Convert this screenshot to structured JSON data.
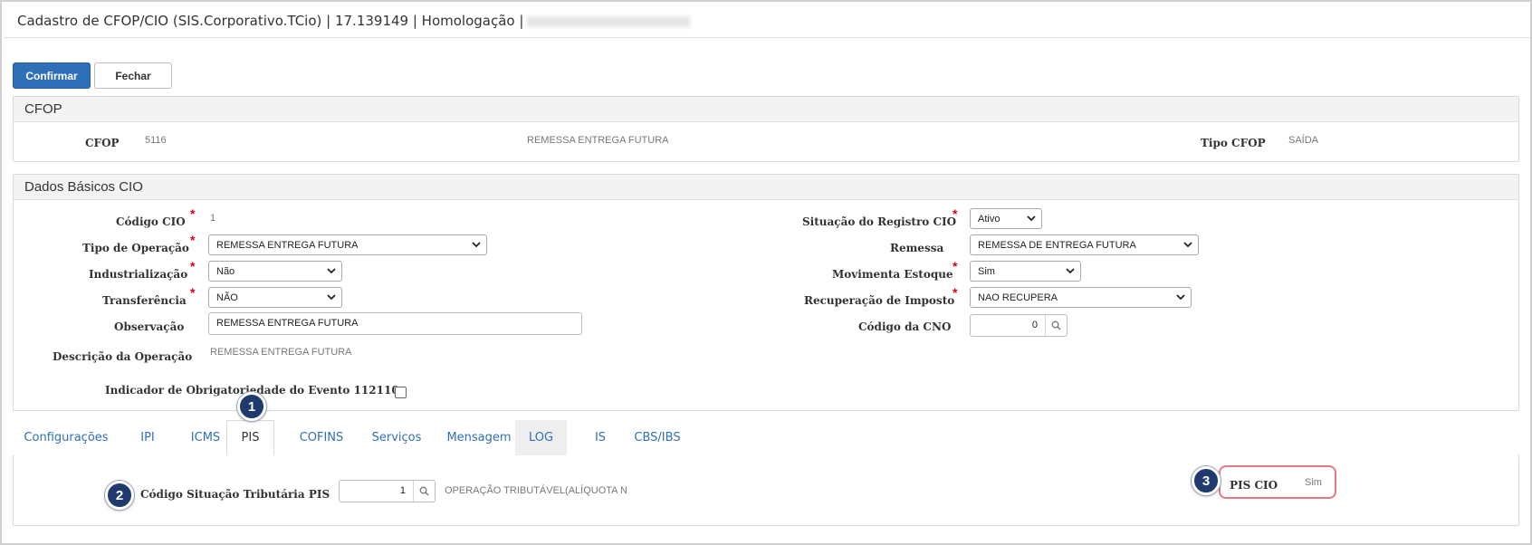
{
  "window": {
    "title": "Cadastro de CFOP/CIO (SIS.Corporativo.TCio) | 17.139149 | Homologação |"
  },
  "toolbar": {
    "confirm_label": "Confirmar",
    "close_label": "Fechar"
  },
  "cfop_panel": {
    "title": "CFOP",
    "cfop_label": "CFOP",
    "cfop_code": "5116",
    "cfop_description": "REMESSA ENTREGA FUTURA",
    "tipo_label": "Tipo CFOP",
    "tipo_value": "SAÍDA"
  },
  "cio_panel": {
    "title": "Dados Básicos CIO",
    "codigo_label": "Código CIO",
    "codigo_value": "1",
    "tipo_operacao_label": "Tipo de Operação",
    "tipo_operacao_value": "REMESSA ENTREGA FUTURA",
    "industrializacao_label": "Industrialização",
    "industrializacao_value": "Não",
    "transferencia_label": "Transferência",
    "transferencia_value": "NÃO",
    "observacao_label": "Observação",
    "observacao_value": "REMESSA ENTREGA FUTURA",
    "descricao_label": "Descrição da Operação",
    "descricao_value": "REMESSA ENTREGA FUTURA",
    "indicador_label": "Indicador de Obrigatoriedade do Evento 112110",
    "situacao_label": "Situação do Registro CIO",
    "situacao_value": "Ativo",
    "remessa_label": "Remessa",
    "remessa_value": "REMESSA DE ENTREGA FUTURA",
    "movimenta_label": "Movimenta Estoque",
    "movimenta_value": "Sim",
    "recuperacao_label": "Recuperação de Imposto",
    "recuperacao_value": "NAO RECUPERA",
    "cno_label": "Código da CNO",
    "cno_value": "0",
    "required_mark": "*"
  },
  "tabs": [
    {
      "label": "Configurações"
    },
    {
      "label": "IPI"
    },
    {
      "label": "ICMS"
    },
    {
      "label": "PIS"
    },
    {
      "label": "COFINS"
    },
    {
      "label": "Serviços"
    },
    {
      "label": "Mensagem"
    },
    {
      "label": "LOG"
    },
    {
      "label": "IS"
    },
    {
      "label": "CBS/IBS"
    }
  ],
  "pis_tab": {
    "cst_label": "Código Situação Tributária PIS",
    "cst_value": "1",
    "cst_description": "OPERAÇÃO TRIBUTÁVEL(ALÍQUOTA N",
    "pis_cio_label": "PIS CIO",
    "pis_cio_value": "Sim"
  },
  "callouts": [
    "1",
    "2",
    "3"
  ],
  "colors": {
    "primary": "#2f6fb7",
    "required": "#d9001b",
    "badge": "#1f3a6d",
    "highlight": "#e57a86"
  }
}
